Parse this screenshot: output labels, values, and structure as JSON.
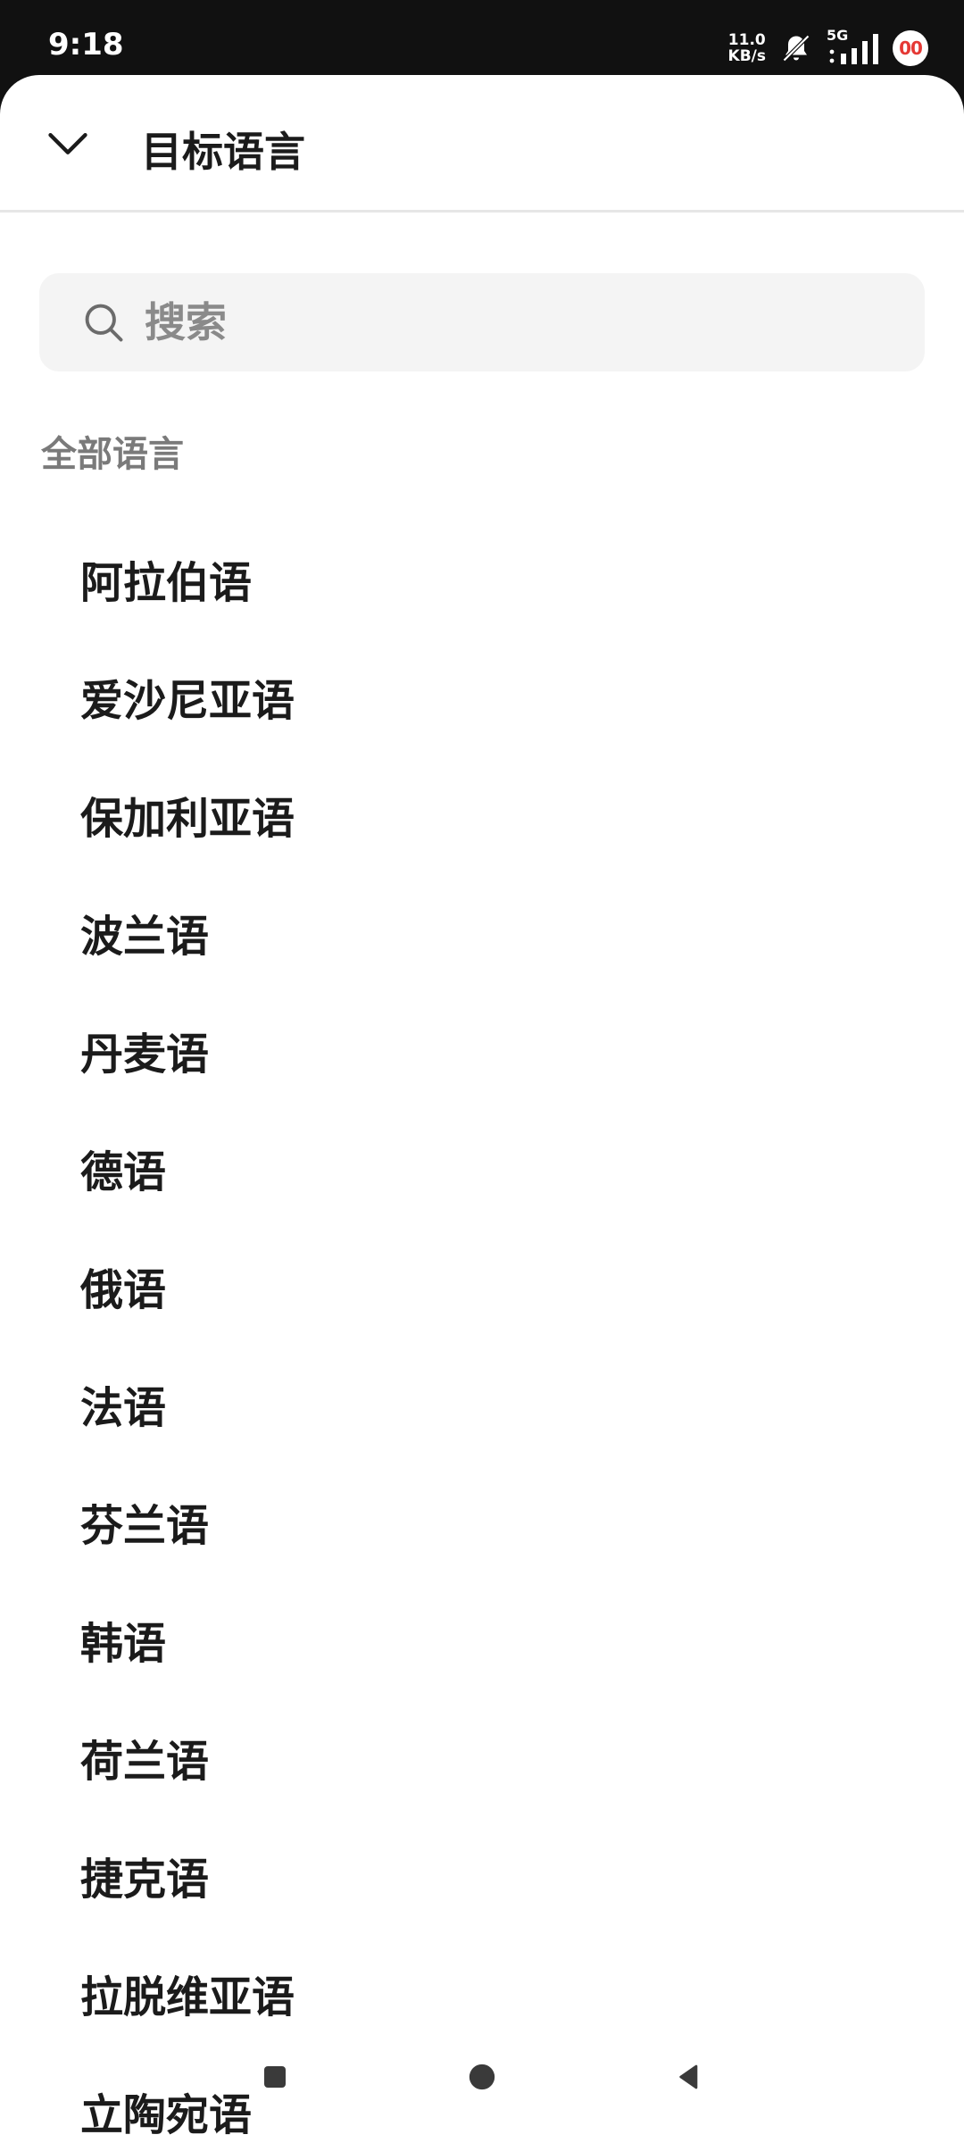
{
  "status_bar": {
    "time": "9:18",
    "net_speed_value": "11.0",
    "net_speed_unit": "KB/s",
    "network_type": "5G",
    "record_badge": "00",
    "icons": [
      "bell-muted-icon",
      "signal-icon",
      "record-badge-icon"
    ]
  },
  "header": {
    "title": "目标语言",
    "collapse_icon": "chevron-down-icon"
  },
  "search": {
    "placeholder": "搜索",
    "value": ""
  },
  "section": {
    "label": "全部语言"
  },
  "languages": [
    "阿拉伯语",
    "爱沙尼亚语",
    "保加利亚语",
    "波兰语",
    "丹麦语",
    "德语",
    "俄语",
    "法语",
    "芬兰语",
    "韩语",
    "荷兰语",
    "捷克语",
    "拉脱维亚语",
    "立陶宛语"
  ],
  "colors": {
    "accent_text": "#1b1b1b",
    "muted_text": "#7a7a7a",
    "search_bg": "#f4f4f4",
    "badge_red": "#e53935"
  }
}
